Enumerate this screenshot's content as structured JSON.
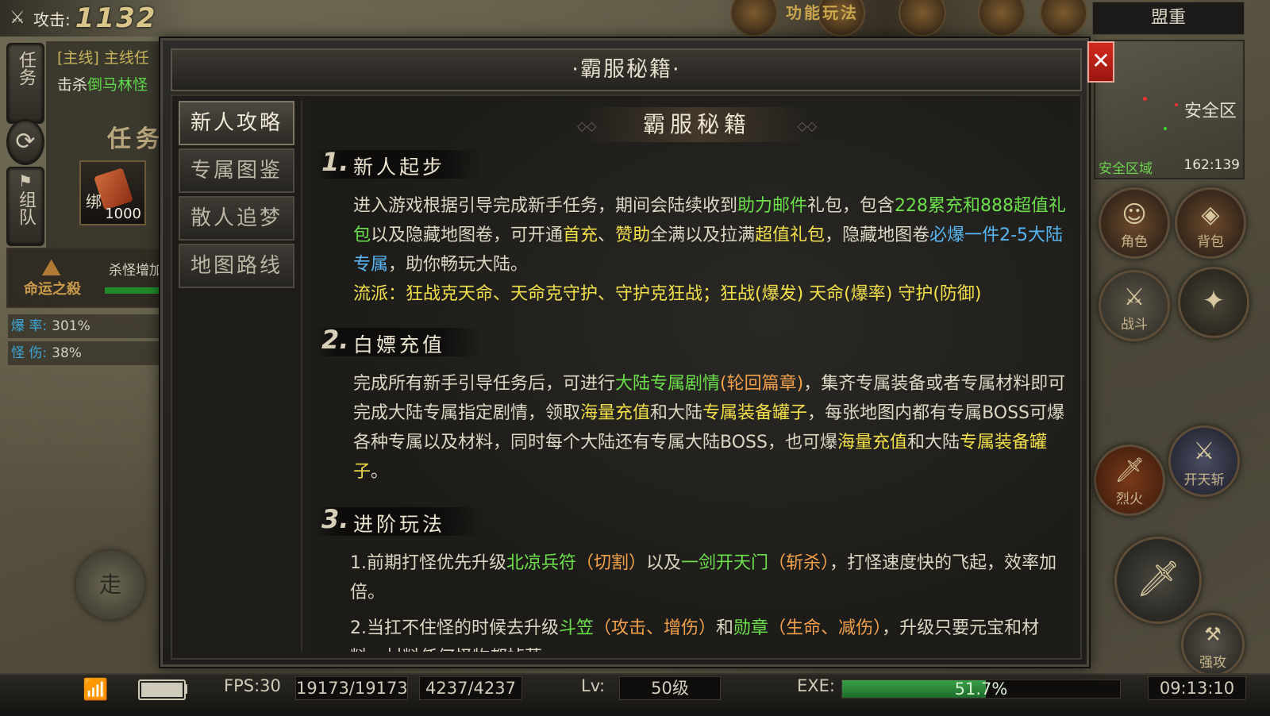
{
  "top_left": {
    "attack_label": "攻击:",
    "attack_value": "1132"
  },
  "left_tabs": {
    "task": "任务",
    "team": "组队"
  },
  "quest": {
    "line1": "[主线] 主线任",
    "line2_prefix": "击杀",
    "line2_target": "倒马林怪",
    "panel_title": "任务",
    "item_bound": "绑",
    "item_count": "1000"
  },
  "fate": {
    "name": "命运之殺",
    "desc": "杀怪增加"
  },
  "stats": [
    {
      "key": "爆 率:",
      "value": "301%"
    },
    {
      "key": "怪 伤:",
      "value": "38%"
    }
  ],
  "walk_label": "走",
  "func_label": "功能玩法",
  "right": {
    "alliance": "盟重",
    "minimap_safe": "安全区",
    "zone": "安全区域",
    "coords": "162:139",
    "buttons": [
      "角色",
      "背包",
      "战斗",
      "烈火",
      "开天斩",
      "强攻"
    ]
  },
  "bottom": {
    "fps": "FPS:30",
    "hp": "19173/19173",
    "mp": "4237/4237",
    "lv_label": "Lv:",
    "lv_value": "50级",
    "exp_label": "EXE:",
    "exp_text": "51.7%",
    "exp_percent": 51.7,
    "time": "09:13:10"
  },
  "modal": {
    "title": "·霸服秘籍·",
    "close": "✕",
    "tabs": [
      "新人攻略",
      "专属图鉴",
      "散人追梦",
      "地图路线"
    ],
    "active_tab": 0,
    "heading": "霸服秘籍",
    "sections": [
      {
        "num": "1.",
        "title": "新人起步",
        "p1_a": "进入游戏根据引导完成新手任务，期间会陆续收到",
        "p1_b": "助力邮件",
        "p1_c": "礼包，包含",
        "p1_d": "228累充和888超值礼包",
        "p1_e": "以及隐藏地图卷，可开通",
        "p1_f": "首充",
        "p1_g": "、",
        "p1_h": "赞助",
        "p1_i": "全满以及拉满",
        "p1_j": "超值礼包",
        "p1_k": "，隐藏地图卷",
        "p1_l": "必爆一件2-5大陆专属",
        "p1_m": "，助你畅玩大陆。",
        "p2": "流派：狂战克天命、天命克守护、守护克狂战；狂战(爆发) 天命(爆率) 守护(防御)"
      },
      {
        "num": "2.",
        "title": "白嫖充值",
        "p_a": "完成所有新手引导任务后，可进行",
        "p_b": "大陆专属剧情",
        "p_c": "(轮回篇章)",
        "p_d": "，集齐专属装备或者专属材料即可完成大陆专属指定剧情，领取",
        "p_e": "海量充值",
        "p_f": "和大陆",
        "p_g": "专属装备罐子",
        "p_h": "，每张地图内都有专属BOSS可爆各种专属以及材料，同时每个大陆还有专属大陆BOSS，也可爆",
        "p_i": "海量充值",
        "p_j": "和大陆",
        "p_k": "专属装备罐子",
        "p_l": "。"
      },
      {
        "num": "3.",
        "title": "进阶玩法",
        "l1_a": "1.前期打怪优先升级",
        "l1_b": "北凉兵符",
        "l1_c": "（切割）",
        "l1_d": "以及",
        "l1_e": "一剑开天门",
        "l1_f": "（斩杀）",
        "l1_g": "，打怪速度快的飞起，效率加倍。",
        "l2_a": "2.当扛不住怪的时候去升级",
        "l2_b": "斗笠",
        "l2_c": "（攻击、增伤）",
        "l2_d": "和",
        "l2_e": "勋章",
        "l2_f": "（生命、减伤）",
        "l2_g": "，升级只要元宝和材料，材料任何怪物都掉落。"
      }
    ]
  }
}
